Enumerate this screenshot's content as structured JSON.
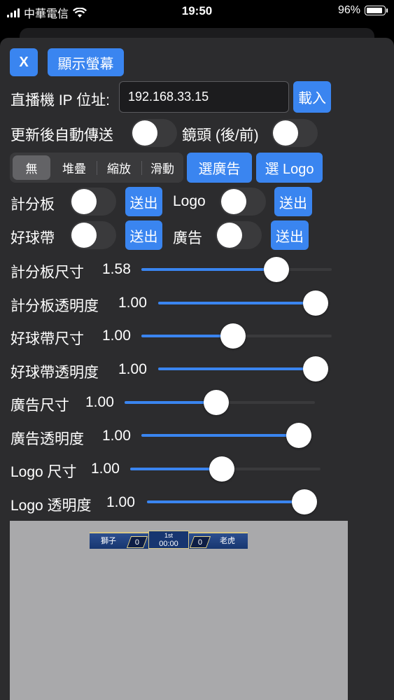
{
  "status_bar": {
    "carrier": "中華電信",
    "time": "19:50",
    "battery": "96%"
  },
  "header": {
    "close_label": "X",
    "show_screen_label": "顯示螢幕"
  },
  "ip": {
    "label": "直播機 IP 位址:",
    "value": "192.168.33.15",
    "load_label": "載入"
  },
  "auto_send": {
    "label": "更新後自動傳送",
    "on": false
  },
  "lens": {
    "label": "鏡頭 (後/前)",
    "on": false
  },
  "transition_segment": {
    "options": [
      "無",
      "堆疊",
      "縮放",
      "滑動"
    ],
    "selected": "無"
  },
  "choose_ad_label": "選廣告",
  "choose_logo_label": "選 Logo",
  "toggles": {
    "scoreboard": {
      "label": "計分板",
      "on": false,
      "send": "送出"
    },
    "logo": {
      "label": "Logo",
      "on": false,
      "send": "送出"
    },
    "ticker": {
      "label": "好球帶",
      "on": false,
      "send": "送出"
    },
    "ad": {
      "label": "廣告",
      "on": false,
      "send": "送出"
    }
  },
  "sliders": [
    {
      "label": "計分板尺寸",
      "value": "1.58",
      "fraction": 0.74
    },
    {
      "label": "計分板透明度",
      "value": "1.00",
      "fraction": 1.0
    },
    {
      "label": "好球帶尺寸",
      "value": "1.00",
      "fraction": 0.48
    },
    {
      "label": "好球帶透明度",
      "value": "1.00",
      "fraction": 1.0
    },
    {
      "label": "廣告尺寸",
      "value": "1.00",
      "fraction": 0.48
    },
    {
      "label": "廣告透明度",
      "value": "1.00",
      "fraction": 1.0
    },
    {
      "label": "Logo 尺寸",
      "value": "1.00",
      "fraction": 0.48
    },
    {
      "label": "Logo 透明度",
      "value": "1.00",
      "fraction": 1.0
    }
  ],
  "preview": {
    "home_team": "獅子",
    "home_score": "0",
    "inning": "1st",
    "clock": "00:00",
    "away_score": "0",
    "away_team": "老虎"
  },
  "colors": {
    "accent": "#3a85f0",
    "sheet": "#2c2c2e",
    "preview_bg": "#a9a9ab"
  }
}
